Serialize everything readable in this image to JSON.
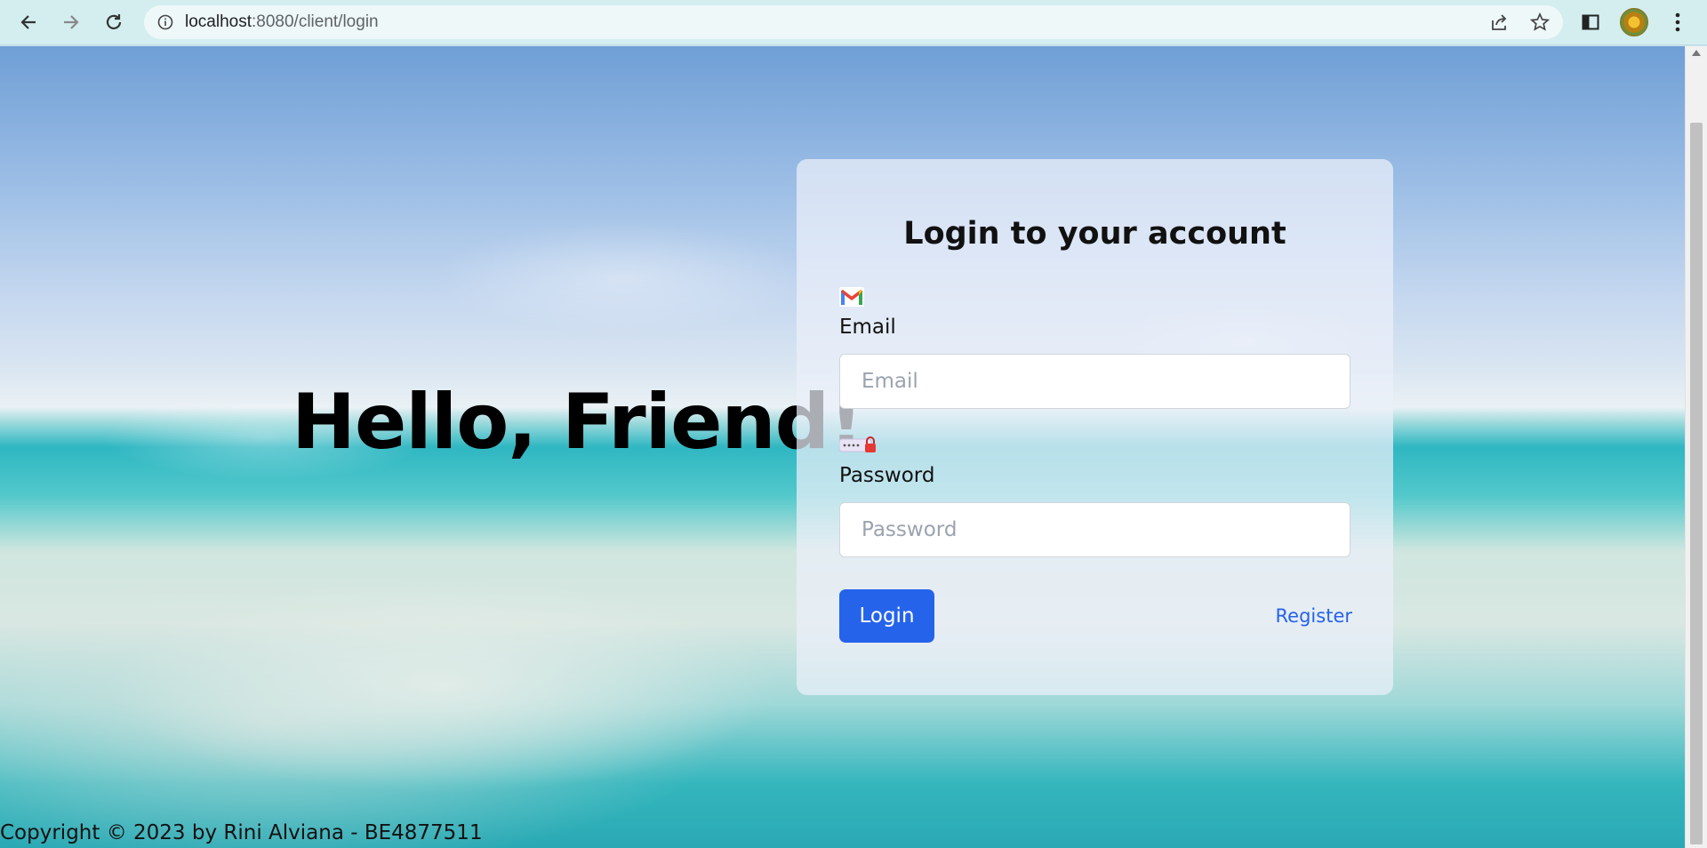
{
  "browser": {
    "url_host": "localhost",
    "url_path": ":8080/client/login",
    "icons": [
      "back-arrow-icon",
      "forward-arrow-icon",
      "reload-icon",
      "info-icon",
      "share-icon",
      "star-icon",
      "sidepanel-icon",
      "profile-avatar",
      "menu-dots-icon"
    ]
  },
  "hero": {
    "greeting": "Hello, Friend!"
  },
  "login_card": {
    "title": "Login to your account",
    "email_label": "Email",
    "email_placeholder": "Email",
    "email_value": "",
    "password_label": "Password",
    "password_placeholder": "Password",
    "password_value": "",
    "login_button": "Login",
    "register_link": "Register"
  },
  "footer": {
    "copyright": "Copyright © 2023 by Rini Alviana - BE4877511"
  },
  "colors": {
    "primary": "#2563eb",
    "chrome_bg": "#d4eef0"
  }
}
